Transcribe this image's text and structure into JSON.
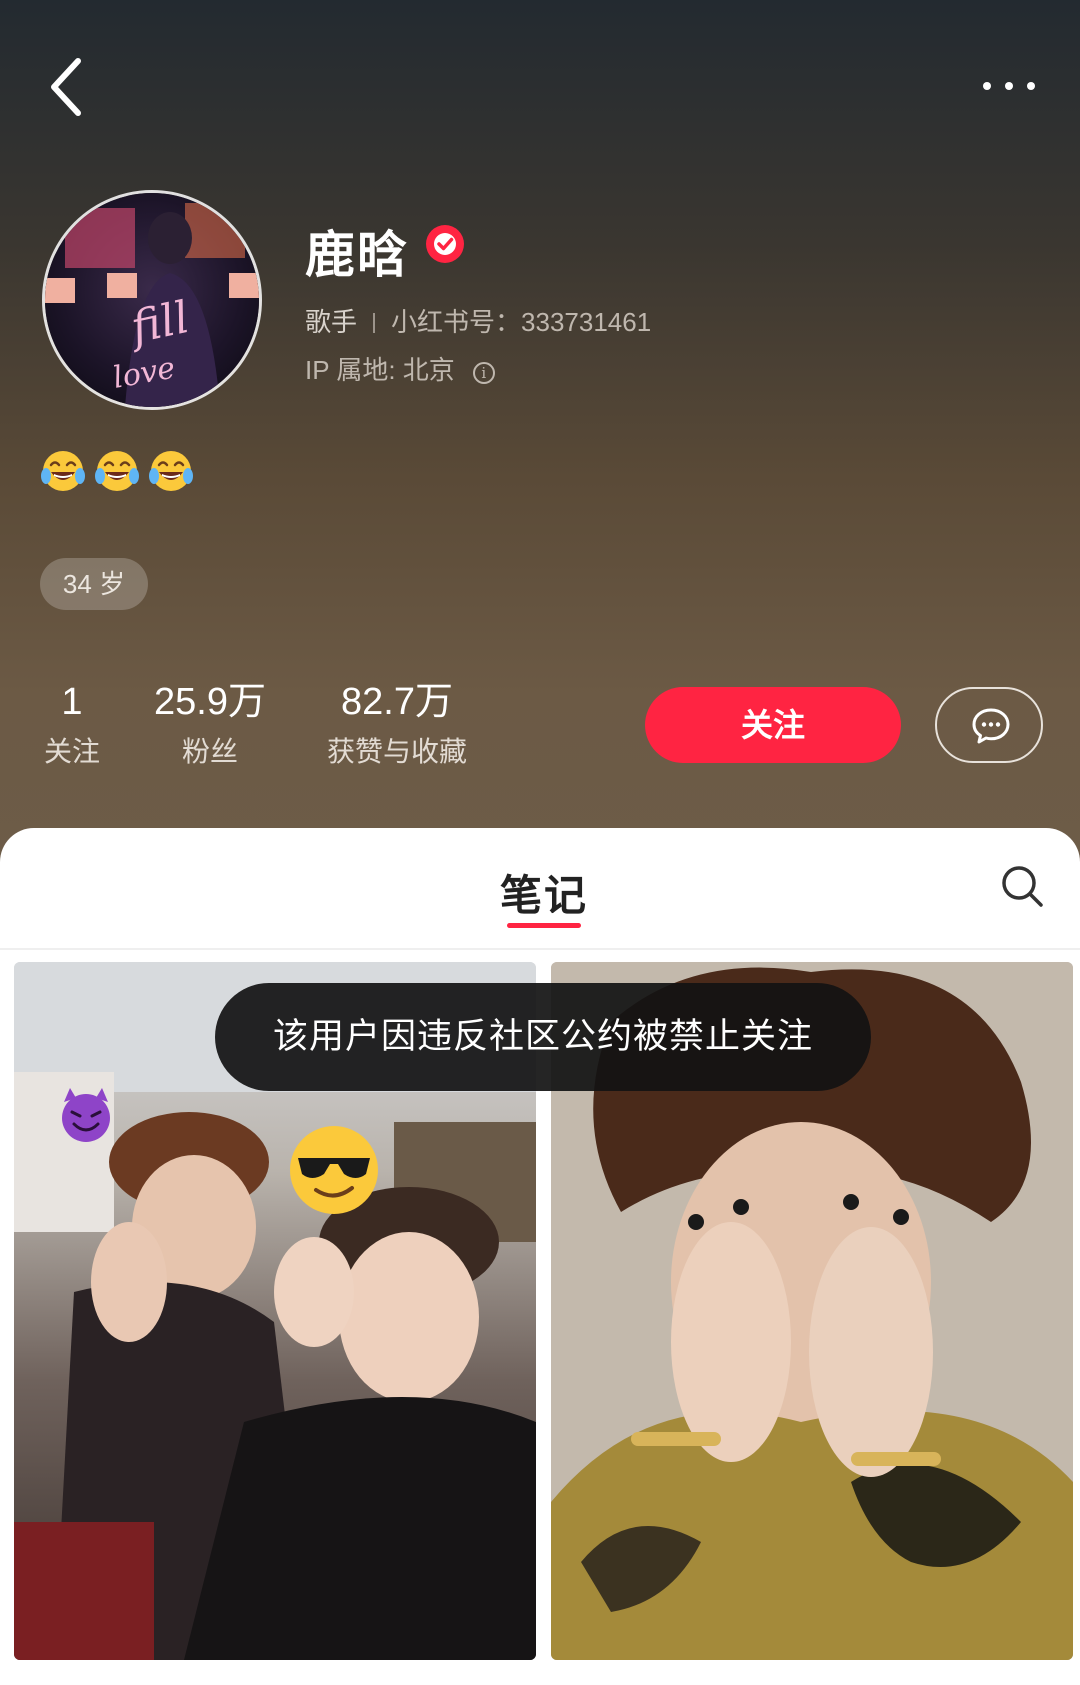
{
  "profile": {
    "name": "鹿晗",
    "occupation": "歌手",
    "id_label": "小红书号：",
    "id_value": "333731461",
    "ip_label": "IP 属地: 北京",
    "bio_emojis": [
      "tears-of-joy-emoji",
      "tears-of-joy-emoji",
      "tears-of-joy-emoji"
    ],
    "age_tag": "34 岁"
  },
  "stats": [
    {
      "value": "1",
      "label": "关注"
    },
    {
      "value": "25.9万",
      "label": "粉丝"
    },
    {
      "value": "82.7万",
      "label": "获赞与收藏"
    }
  ],
  "actions": {
    "follow_label": "关注",
    "message_icon": "chat-bubble-icon"
  },
  "tabs": {
    "notes_label": "笔记"
  },
  "toast": {
    "text": "该用户因违反社区公约被禁止关注"
  },
  "icons": {
    "back": "chevron-left-icon",
    "more": "more-dots-icon",
    "verified": "verified-badge-icon",
    "search": "search-icon"
  },
  "colors": {
    "accent": "#ff2442",
    "header_top": "#232a30",
    "header_bottom": "#6d5c48"
  }
}
